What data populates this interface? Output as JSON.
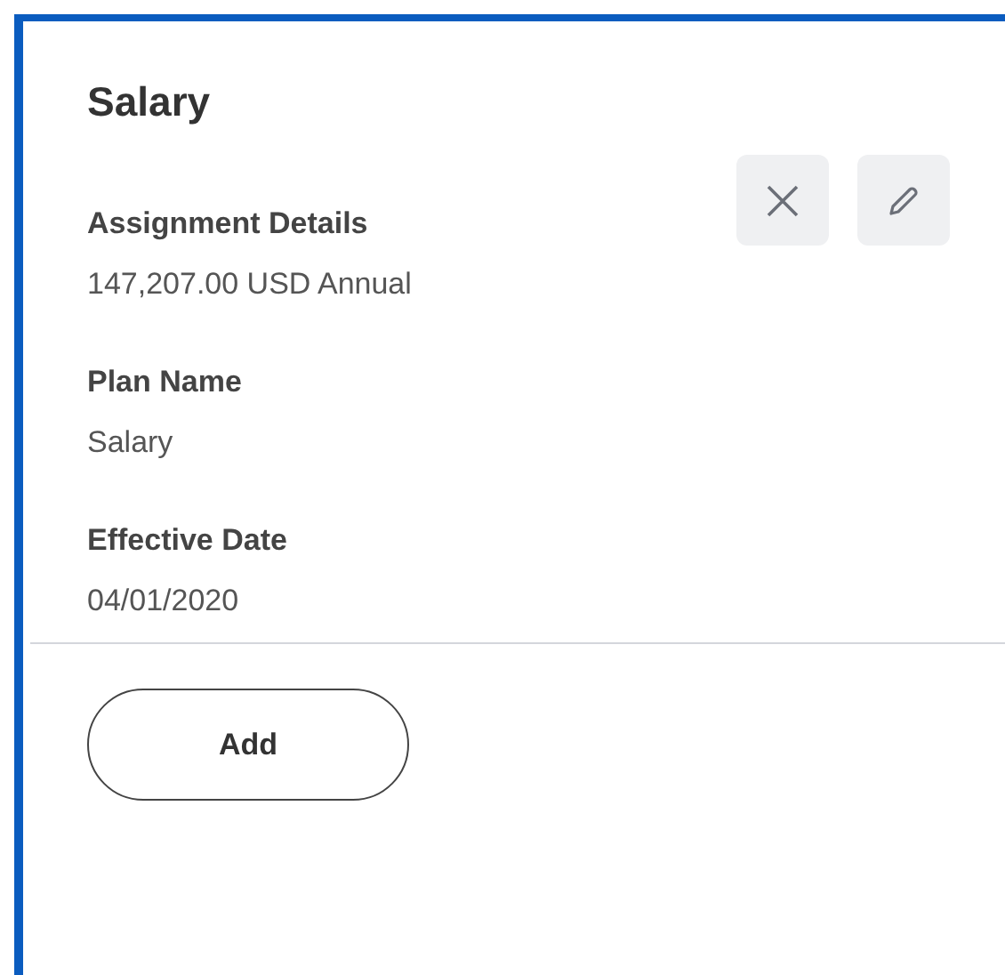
{
  "title": "Salary",
  "fields": [
    {
      "label": "Assignment Details",
      "value": "147,207.00 USD Annual"
    },
    {
      "label": "Plan Name",
      "value": "Salary"
    },
    {
      "label": "Effective Date",
      "value": "04/01/2020"
    }
  ],
  "actions": [
    {
      "kind": "remove"
    },
    {
      "kind": "edit"
    }
  ],
  "add_button": "Add"
}
